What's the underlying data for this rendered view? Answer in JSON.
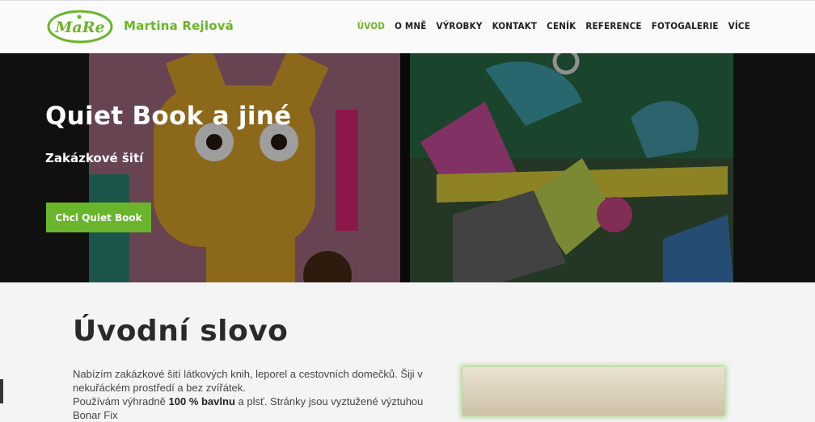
{
  "logo": {
    "text": "MaRe"
  },
  "brand": {
    "name": "Martina Rejlová"
  },
  "nav": {
    "items": [
      {
        "label": "ÚVOD",
        "active": true
      },
      {
        "label": "O MNĚ",
        "active": false
      },
      {
        "label": "VÝROBKY",
        "active": false
      },
      {
        "label": "KONTAKT",
        "active": false
      },
      {
        "label": "CENÍK",
        "active": false
      },
      {
        "label": "REFERENCE",
        "active": false
      },
      {
        "label": "FOTOGALERIE",
        "active": false
      },
      {
        "label": "VÍCE",
        "active": false
      }
    ]
  },
  "hero": {
    "title": "Quiet Book a jiné",
    "subtitle": "Zakázkové šití",
    "cta_label": "Chci Quiet Book"
  },
  "intro": {
    "heading": "Úvodní slovo",
    "line1": "Nabízím zakázkové šití látkových knih, leporel a cestovních domečků. Šiji v nekuřáckém prostředí a bez zvířátek.",
    "line2_start": "Používám výhradně ",
    "line2_bold": "100 % bavlnu",
    "line2_end": " a plsť. Stránky jsou vyztužené výztuhou Bonar Fix"
  },
  "colors": {
    "accent": "#6bb52c",
    "text": "#2a2a2a"
  }
}
